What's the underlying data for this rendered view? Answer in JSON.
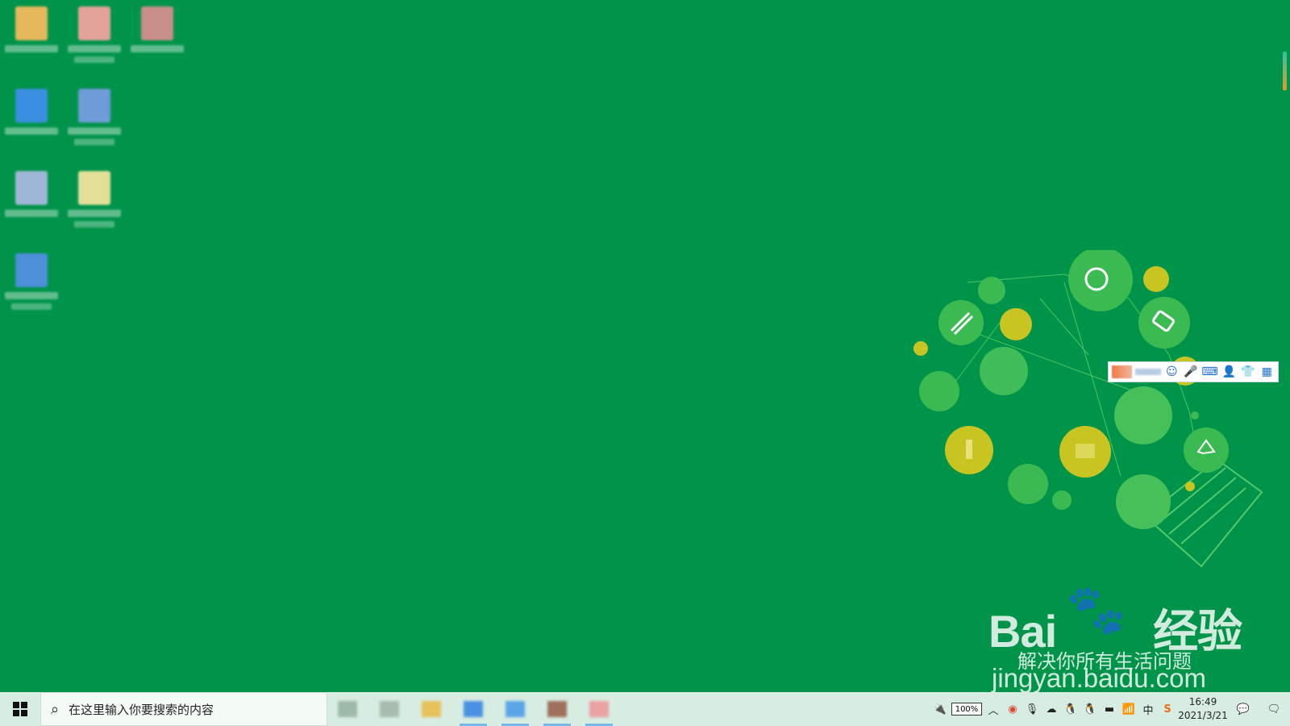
{
  "desktop": {
    "background_color": "#00944a",
    "icons": [
      {
        "name": "desktop-icon-1",
        "color": "#e5b85c"
      },
      {
        "name": "desktop-icon-2",
        "color": "#e3a39a"
      },
      {
        "name": "desktop-icon-3",
        "color": "#c98f8a"
      },
      {
        "name": "desktop-icon-4",
        "color": "#3b8fe0"
      },
      {
        "name": "desktop-icon-5",
        "color": "#6f9bd8"
      },
      {
        "name": "desktop-icon-6",
        "color": "#9fb7d6"
      },
      {
        "name": "desktop-icon-7",
        "color": "#e2e097"
      },
      {
        "name": "desktop-icon-8",
        "color": "#4d8fd9"
      }
    ]
  },
  "ime_toolbar": {
    "buttons": [
      "smiley-icon",
      "microphone-icon",
      "keyboard-icon",
      "user-icon",
      "shirt-icon",
      "grid-icon"
    ]
  },
  "watermark": {
    "logo_text": "Bai",
    "logo_text2": "经验",
    "slogan": "解决你所有生活问题",
    "url": "jingyan.baidu.com"
  },
  "taskbar": {
    "search_placeholder": "在这里输入你要搜索的内容",
    "apps": [
      {
        "name": "taskbar-app-1",
        "color": "#9fb9a9",
        "active": false
      },
      {
        "name": "taskbar-app-2",
        "color": "#a7bbaf",
        "active": false
      },
      {
        "name": "taskbar-app-3",
        "color": "#e7c15a",
        "active": false
      },
      {
        "name": "taskbar-app-4",
        "color": "#4a90e2",
        "active": true
      },
      {
        "name": "taskbar-app-5",
        "color": "#5aa5e6",
        "active": true
      },
      {
        "name": "taskbar-app-6",
        "color": "#a0705c",
        "active": true
      },
      {
        "name": "taskbar-app-7",
        "color": "#eaa1a1",
        "active": true
      }
    ],
    "tray": {
      "battery": "100%",
      "ime_lang": "中",
      "time": "16:49",
      "date": "2021/3/21"
    }
  }
}
